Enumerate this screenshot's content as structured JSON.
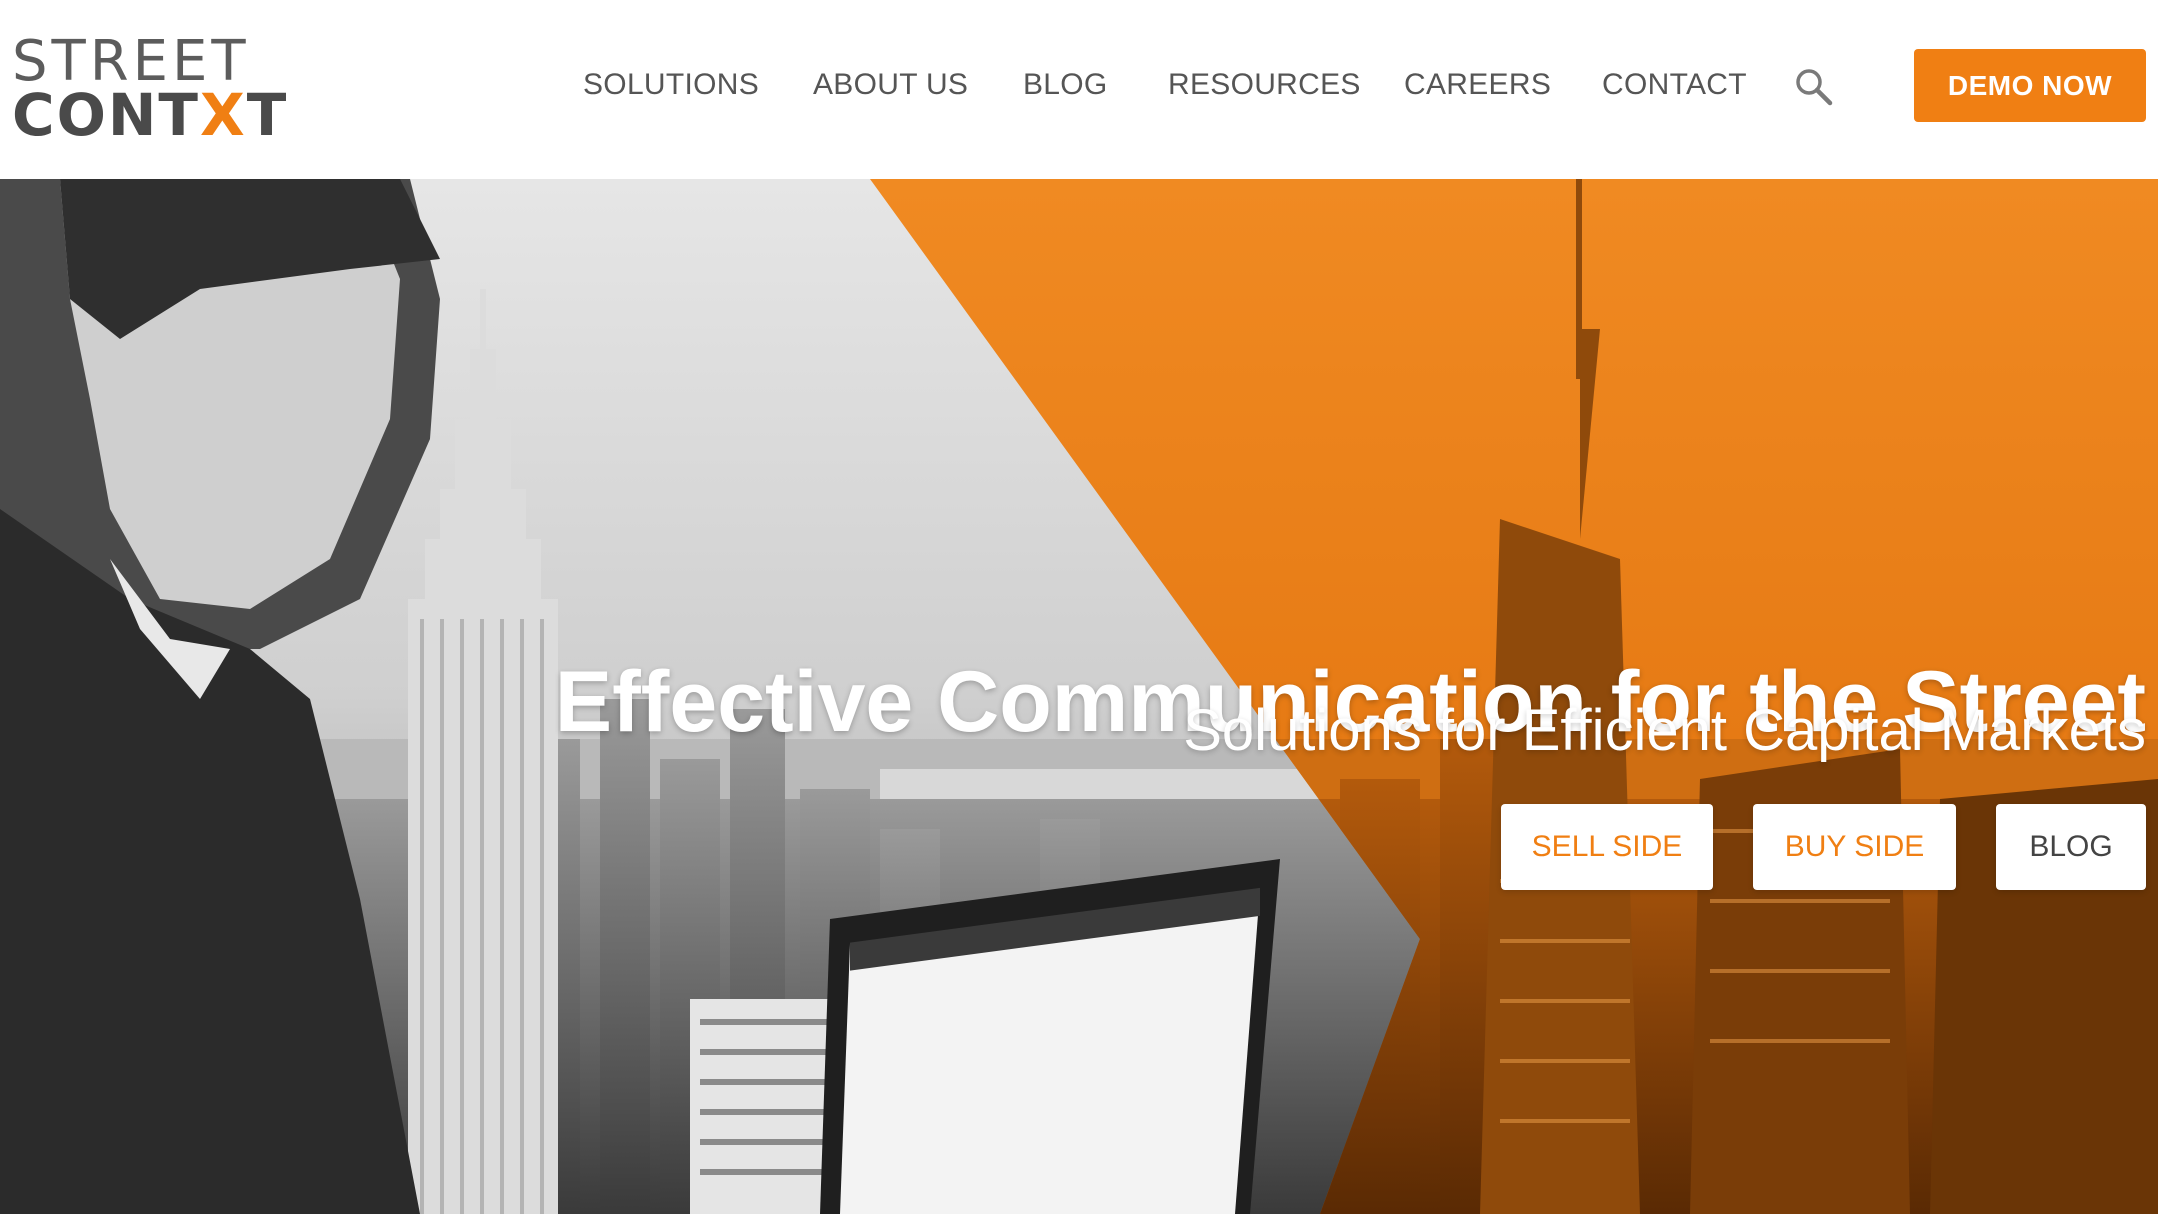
{
  "brand": {
    "logo_line1": "STREET",
    "logo_line2_prefix": "CONT",
    "logo_line2_x": "X",
    "logo_line2_suffix": "T",
    "accent_color": "#f07f13"
  },
  "nav": {
    "items": [
      {
        "label": "SOLUTIONS"
      },
      {
        "label": "ABOUT US"
      },
      {
        "label": "BLOG"
      },
      {
        "label": "RESOURCES"
      },
      {
        "label": "CAREERS"
      },
      {
        "label": "CONTACT"
      }
    ],
    "search_icon": "search-icon",
    "demo_label": "DEMO NOW"
  },
  "hero": {
    "title": "Effective Communication for the Street",
    "subtitle": "Solutions for Efficient Capital Markets",
    "buttons": [
      {
        "label": "SELL SIDE"
      },
      {
        "label": "BUY SIDE"
      },
      {
        "label": "BLOG"
      }
    ]
  }
}
